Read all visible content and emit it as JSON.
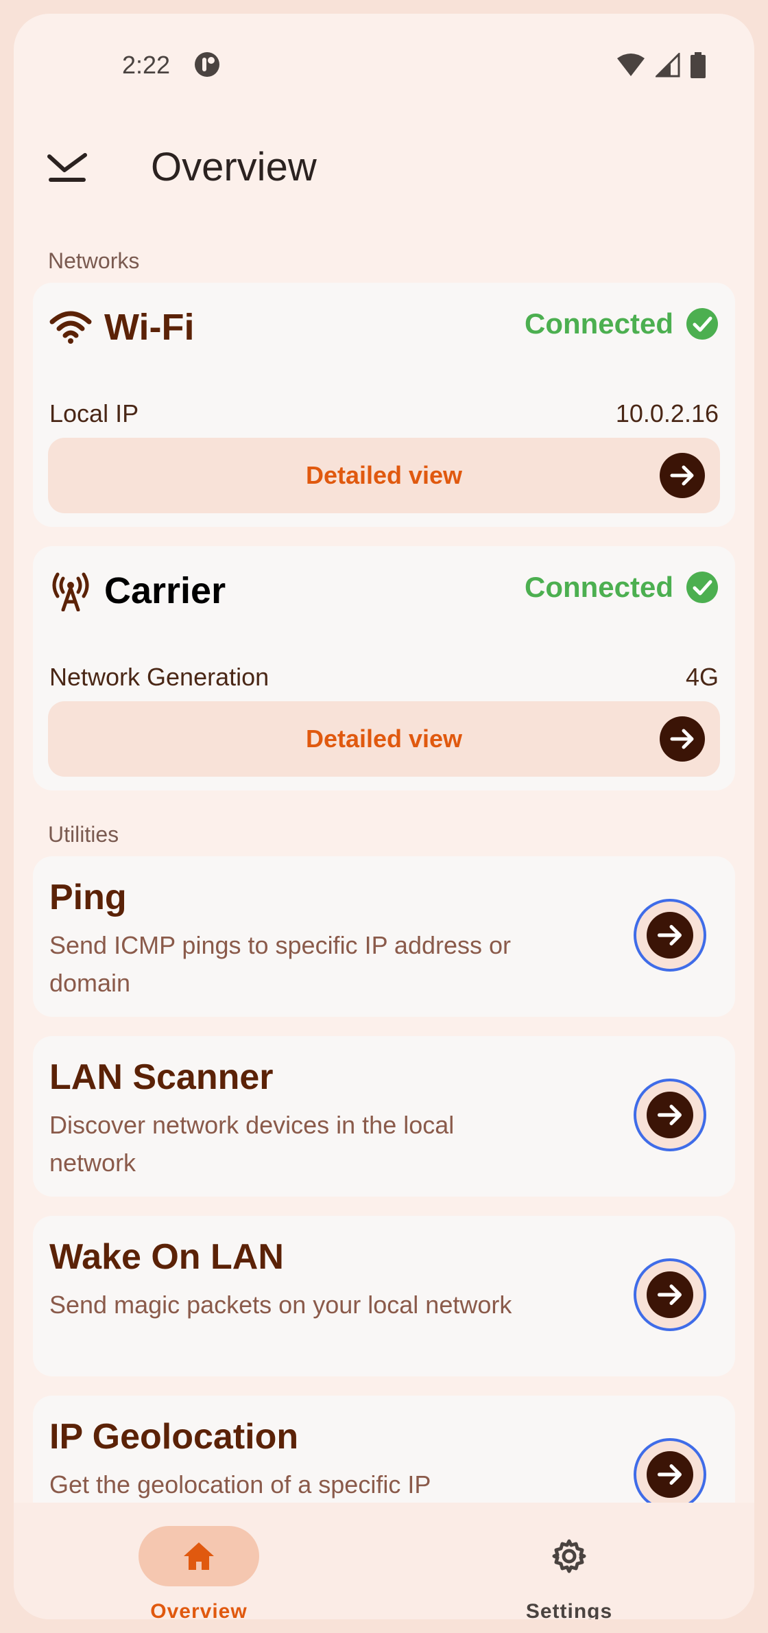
{
  "status_bar": {
    "time": "2:22"
  },
  "app_bar": {
    "title": "Overview"
  },
  "sections": {
    "networks": "Networks",
    "utilities": "Utilities"
  },
  "networks": [
    {
      "title": "Wi-Fi",
      "status": "Connected",
      "row_label": "Local IP",
      "row_value": "10.0.2.16",
      "button": "Detailed view",
      "icon": "wifi-icon"
    },
    {
      "title": "Carrier",
      "status": "Connected",
      "row_label": "Network Generation",
      "row_value": "4G",
      "button": "Detailed view",
      "icon": "cell-tower-icon"
    }
  ],
  "utilities": [
    {
      "title": "Ping",
      "desc": "Send ICMP pings to specific IP address or domain"
    },
    {
      "title": "LAN Scanner",
      "desc": "Discover network devices in the local network"
    },
    {
      "title": "Wake On LAN",
      "desc": "Send magic packets on your local network"
    },
    {
      "title": "IP Geolocation",
      "desc": "Get the geolocation of a specific IP"
    }
  ],
  "bottom_nav": [
    {
      "label": "Overview",
      "icon": "home-icon",
      "selected": true
    },
    {
      "label": "Settings",
      "icon": "gear-icon",
      "selected": false
    }
  ],
  "colors": {
    "connected": "#4caf50",
    "accent": "#e0590f",
    "title_brown": "#5b2207",
    "focus_ring": "#3f6ce8"
  }
}
